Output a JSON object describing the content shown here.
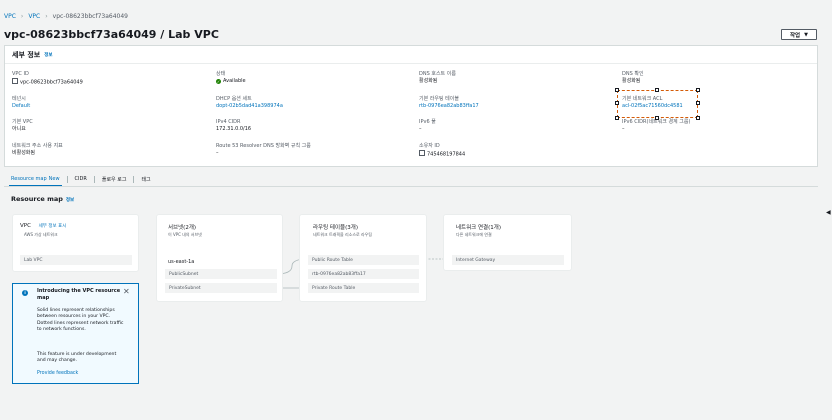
{
  "breadcrumb": [
    "VPC",
    "VPC",
    "vpc-08623bbcf73a64049"
  ],
  "page": {
    "title": "vpc-08623bbcf73a64049 / Lab VPC",
    "action_label": "작업"
  },
  "details": {
    "title": "세부 정보",
    "info": "정보",
    "fields": {
      "vpc_id": {
        "label": "VPC ID",
        "value": "vpc-08623bbcf73a64049"
      },
      "state": {
        "label": "상태",
        "value": "Available"
      },
      "dns_hostnames": {
        "label": "DNS 호스트 이름",
        "value": "활성화됨"
      },
      "dns_resolution": {
        "label": "DNS 확인",
        "value": "활성화됨"
      },
      "tenancy": {
        "label": "테넌시",
        "value": "Default"
      },
      "dhcp": {
        "label": "DHCP 옵션 세트",
        "value": "dopt-02b5dad41a398974a"
      },
      "main_rt": {
        "label": "기본 라우팅 테이블",
        "value": "rtb-0976ea82ab83ffa17"
      },
      "main_acl": {
        "label": "기본 네트워크 ACL",
        "value": "acl-02f5ac71560dc4581"
      },
      "default_vpc": {
        "label": "기본 VPC",
        "value": "아니요"
      },
      "ipv4_cidr": {
        "label": "IPv4 CIDR",
        "value": "172.31.0.0/16"
      },
      "ipv6_pool": {
        "label": "IPv6 풀",
        "value": "–"
      },
      "ipv6_cidr": {
        "label": "IPv6 CIDR(네트워크 경계 그룹)",
        "value": "–"
      },
      "nau": {
        "label": "네트워크 주소 사용 지표",
        "value": "비활성화됨"
      },
      "r53": {
        "label": "Route 53 Resolver DNS 방화벽 규칙 그룹",
        "value": "–"
      },
      "owner": {
        "label": "소유자 ID",
        "value": "745468197844"
      }
    }
  },
  "tabs": [
    {
      "label": "Resource map",
      "badge": "New"
    },
    {
      "label": "CIDR"
    },
    {
      "label": "플로우 로그"
    },
    {
      "label": "태그"
    }
  ],
  "resource_map": {
    "title": "Resource map",
    "info": "정보",
    "vpc_card": {
      "title": "VPC",
      "link": "세부 정보 표시",
      "subtitle": "AWS 가상 네트워크",
      "node": "Lab VPC"
    },
    "subnets_card": {
      "title": "서브넷(2개)",
      "subtitle": "이 VPC 내의 서브넷",
      "az": "us-east-1a",
      "nodes": [
        "PublicSubnet",
        "PrivateSubnet"
      ]
    },
    "rt_card": {
      "title": "라우팅 테이블(3개)",
      "subtitle": "네트워크 트래픽을 리소스로 라우팅",
      "nodes": [
        "Public Route Table",
        "rtb-0976ea82ab83ffa17",
        "Private Route Table"
      ]
    },
    "conn_card": {
      "title": "네트워크 연결(1개)",
      "subtitle": "다른 네트워크에 연결",
      "nodes": [
        "Internet Gateway"
      ]
    }
  },
  "notice": {
    "title": "Introducing the VPC resource map",
    "body1": "Solid lines represent relationships between resources in your VPC. Dotted lines represent network traffic to network functions.",
    "body2": "This feature is under development and may change.",
    "link": "Provide feedback"
  }
}
